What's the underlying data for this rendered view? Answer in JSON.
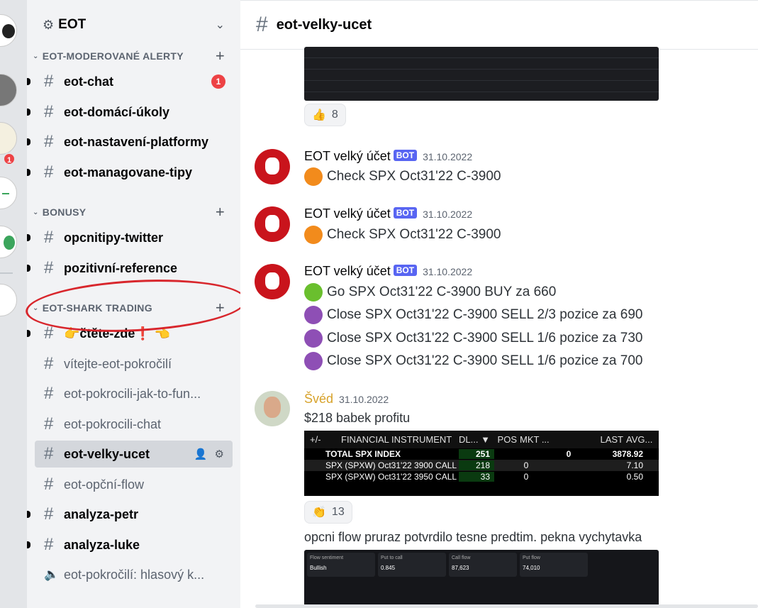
{
  "server": {
    "name": "EOT",
    "rail_badges": [
      "1"
    ]
  },
  "sidebar": {
    "categories": [
      {
        "label": "EOT-MODEROVANÉ ALERTY"
      },
      {
        "label": "BONUSY"
      },
      {
        "label": "EOT-SHARK TRADING"
      }
    ],
    "channels": [
      {
        "label": "eot-chat",
        "badge": "1"
      },
      {
        "label": "eot-domácí-úkoly"
      },
      {
        "label": "eot-nastavení-platformy"
      },
      {
        "label": "eot-managovane-tipy"
      },
      {
        "label": "opcnitipy-twitter"
      },
      {
        "label": "pozitivní-reference"
      },
      {
        "label": "👉čtěte-zde❗ 👈"
      },
      {
        "label": "vítejte-eot-pokročilí"
      },
      {
        "label": "eot-pokrocili-jak-to-fun..."
      },
      {
        "label": "eot-pokrocili-chat"
      },
      {
        "label": "eot-velky-ucet"
      },
      {
        "label": "eot-opční-flow"
      },
      {
        "label": "analyza-petr"
      },
      {
        "label": "analyza-luke"
      },
      {
        "label": "eot-pokročilí: hlasový k..."
      }
    ]
  },
  "header": {
    "channel": "eot-velky-ucet"
  },
  "messages": {
    "reaction_top": {
      "emoji": "👍",
      "count": "8"
    },
    "msg1": {
      "author": "EOT velký účet",
      "tag": "BOT",
      "time": "31.10.2022",
      "lines": [
        "Check SPX Oct31'22 C-3900"
      ]
    },
    "msg2": {
      "author": "EOT velký účet",
      "tag": "BOT",
      "time": "31.10.2022",
      "lines": [
        "Check SPX Oct31'22 C-3900"
      ]
    },
    "msg3": {
      "author": "EOT velký účet",
      "tag": "BOT",
      "time": "31.10.2022",
      "lines": [
        "Go SPX Oct31'22 C-3900 BUY za 660",
        "Close SPX Oct31'22 C-3900 SELL 2/3 pozice za 690",
        "Close SPX Oct31'22 C-3900 SELL 1/6 pozice za 730",
        "Close SPX Oct31'22 C-3900 SELL 1/6 pozice za 700"
      ]
    },
    "msg4": {
      "author": "Švéd",
      "time": "31.10.2022",
      "text": "$218 babek profitu",
      "reaction": {
        "emoji": "👏",
        "count": "13"
      },
      "table": {
        "headers": [
          "+/-",
          "FINANCIAL INSTRUMENT",
          "DL... ▼",
          "POS",
          "MKT ...",
          "LAST",
          "AVG..."
        ],
        "rows": [
          {
            "instrument": "TOTAL SPX INDEX",
            "dl": "251",
            "pos": "",
            "mkt": "0",
            "last": "3878.92"
          },
          {
            "instrument": "SPX (SPXW) Oct31'22 3900 CALL",
            "dl": "218",
            "pos": "0",
            "mkt": "",
            "last": "7.10"
          },
          {
            "instrument": "SPX (SPXW) Oct31'22 3950 CALL",
            "dl": "33",
            "pos": "0",
            "mkt": "",
            "last": "0.50"
          }
        ]
      }
    },
    "msg5": {
      "text": "opcni flow pruraz potvrdilo tesne predtim. pekna vychytavka",
      "flow": {
        "sentiment_label": "Flow sentiment",
        "sentiment": "Bullish",
        "put_call_label": "Put to call",
        "put_call": "0.845",
        "call_flow_label": "Call flow",
        "call_flow": "87,623",
        "put_flow_label": "Put flow",
        "put_flow": "74,010"
      }
    }
  },
  "colors": {
    "accent": "#5865f2",
    "badge": "#ed4245",
    "annotation": "#d8262c"
  }
}
